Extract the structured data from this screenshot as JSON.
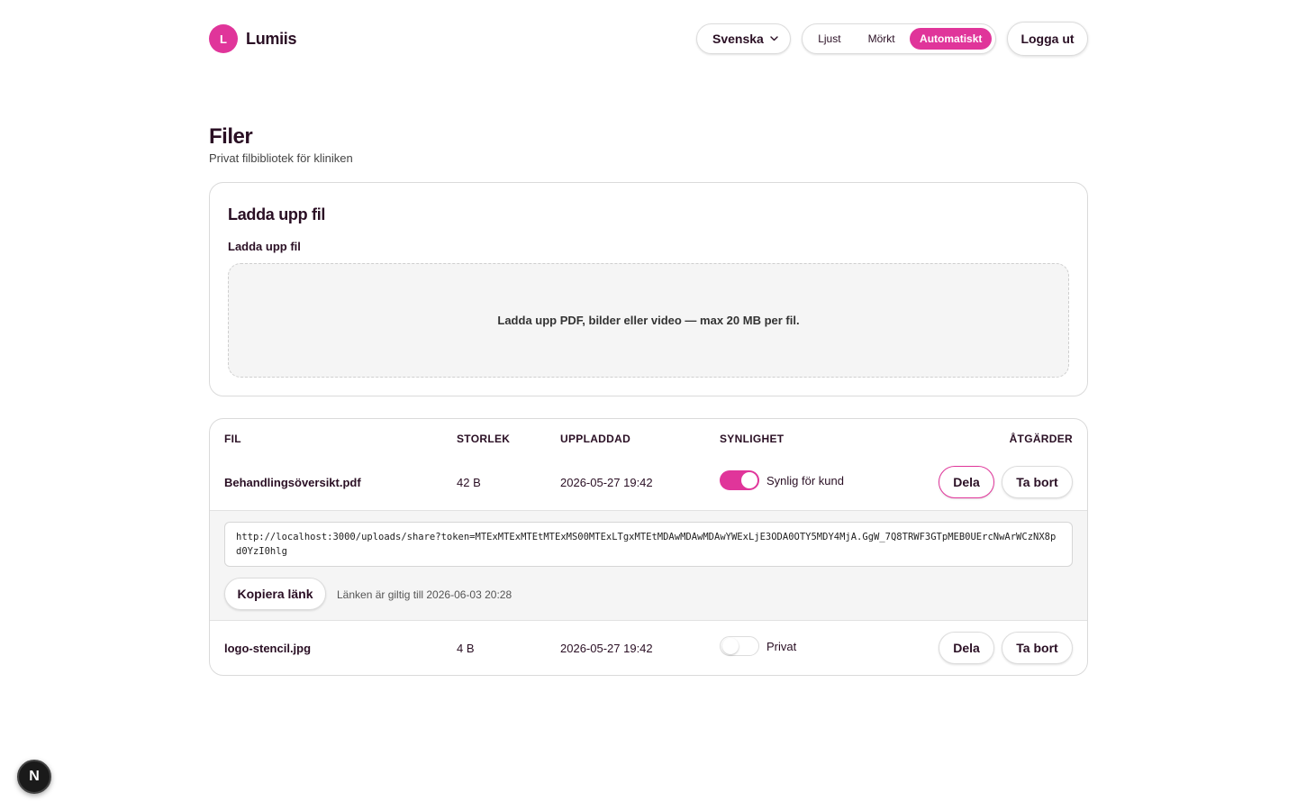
{
  "header": {
    "logo_letter": "L",
    "brand": "Lumiis",
    "language": "Svenska",
    "theme_options": [
      "Ljust",
      "Mörkt",
      "Automatiskt"
    ],
    "theme_selected": "Automatiskt",
    "logout_label": "Logga ut"
  },
  "page": {
    "title": "Filer",
    "subtitle": "Privat filbibliotek för kliniken"
  },
  "upload": {
    "card_title": "Ladda upp fil",
    "field_label": "Ladda upp fil",
    "dropzone_text": "Ladda upp PDF, bilder eller video — max 20 MB per fil."
  },
  "table": {
    "headers": {
      "file": "FIL",
      "size": "STORLEK",
      "uploaded": "UPPLADDAD",
      "visibility": "SYNLIGHET",
      "actions": "ÅTGÄRDER"
    },
    "rows": [
      {
        "name": "Behandlingsöversikt.pdf",
        "size": "42 B",
        "uploaded": "2026-05-27 19:42",
        "visible": true,
        "visibility_label": "Synlig för kund",
        "share_label": "Dela",
        "delete_label": "Ta bort"
      },
      {
        "name": "logo-stencil.jpg",
        "size": "4 B",
        "uploaded": "2026-05-27 19:42",
        "visible": false,
        "visibility_label": "Privat",
        "share_label": "Dela",
        "delete_label": "Ta bort"
      }
    ],
    "share": {
      "url": "http://localhost:3000/uploads/share?token=MTExMTExMTEtMTExMS00MTExLTgxMTEtMDAwMDAwMDAwYWExLjE3ODA0OTY5MDY4MjA.GgW_7Q8TRWF3GTpMEB0UErcNwArWCzNX8pd0YzI0hlg",
      "copy_label": "Kopiera länk",
      "valid_text": "Länken är giltig till 2026-06-03 20:28"
    }
  },
  "dev_badge": "N",
  "colors": {
    "accent": "#e0359a",
    "text": "#2a0f24"
  }
}
